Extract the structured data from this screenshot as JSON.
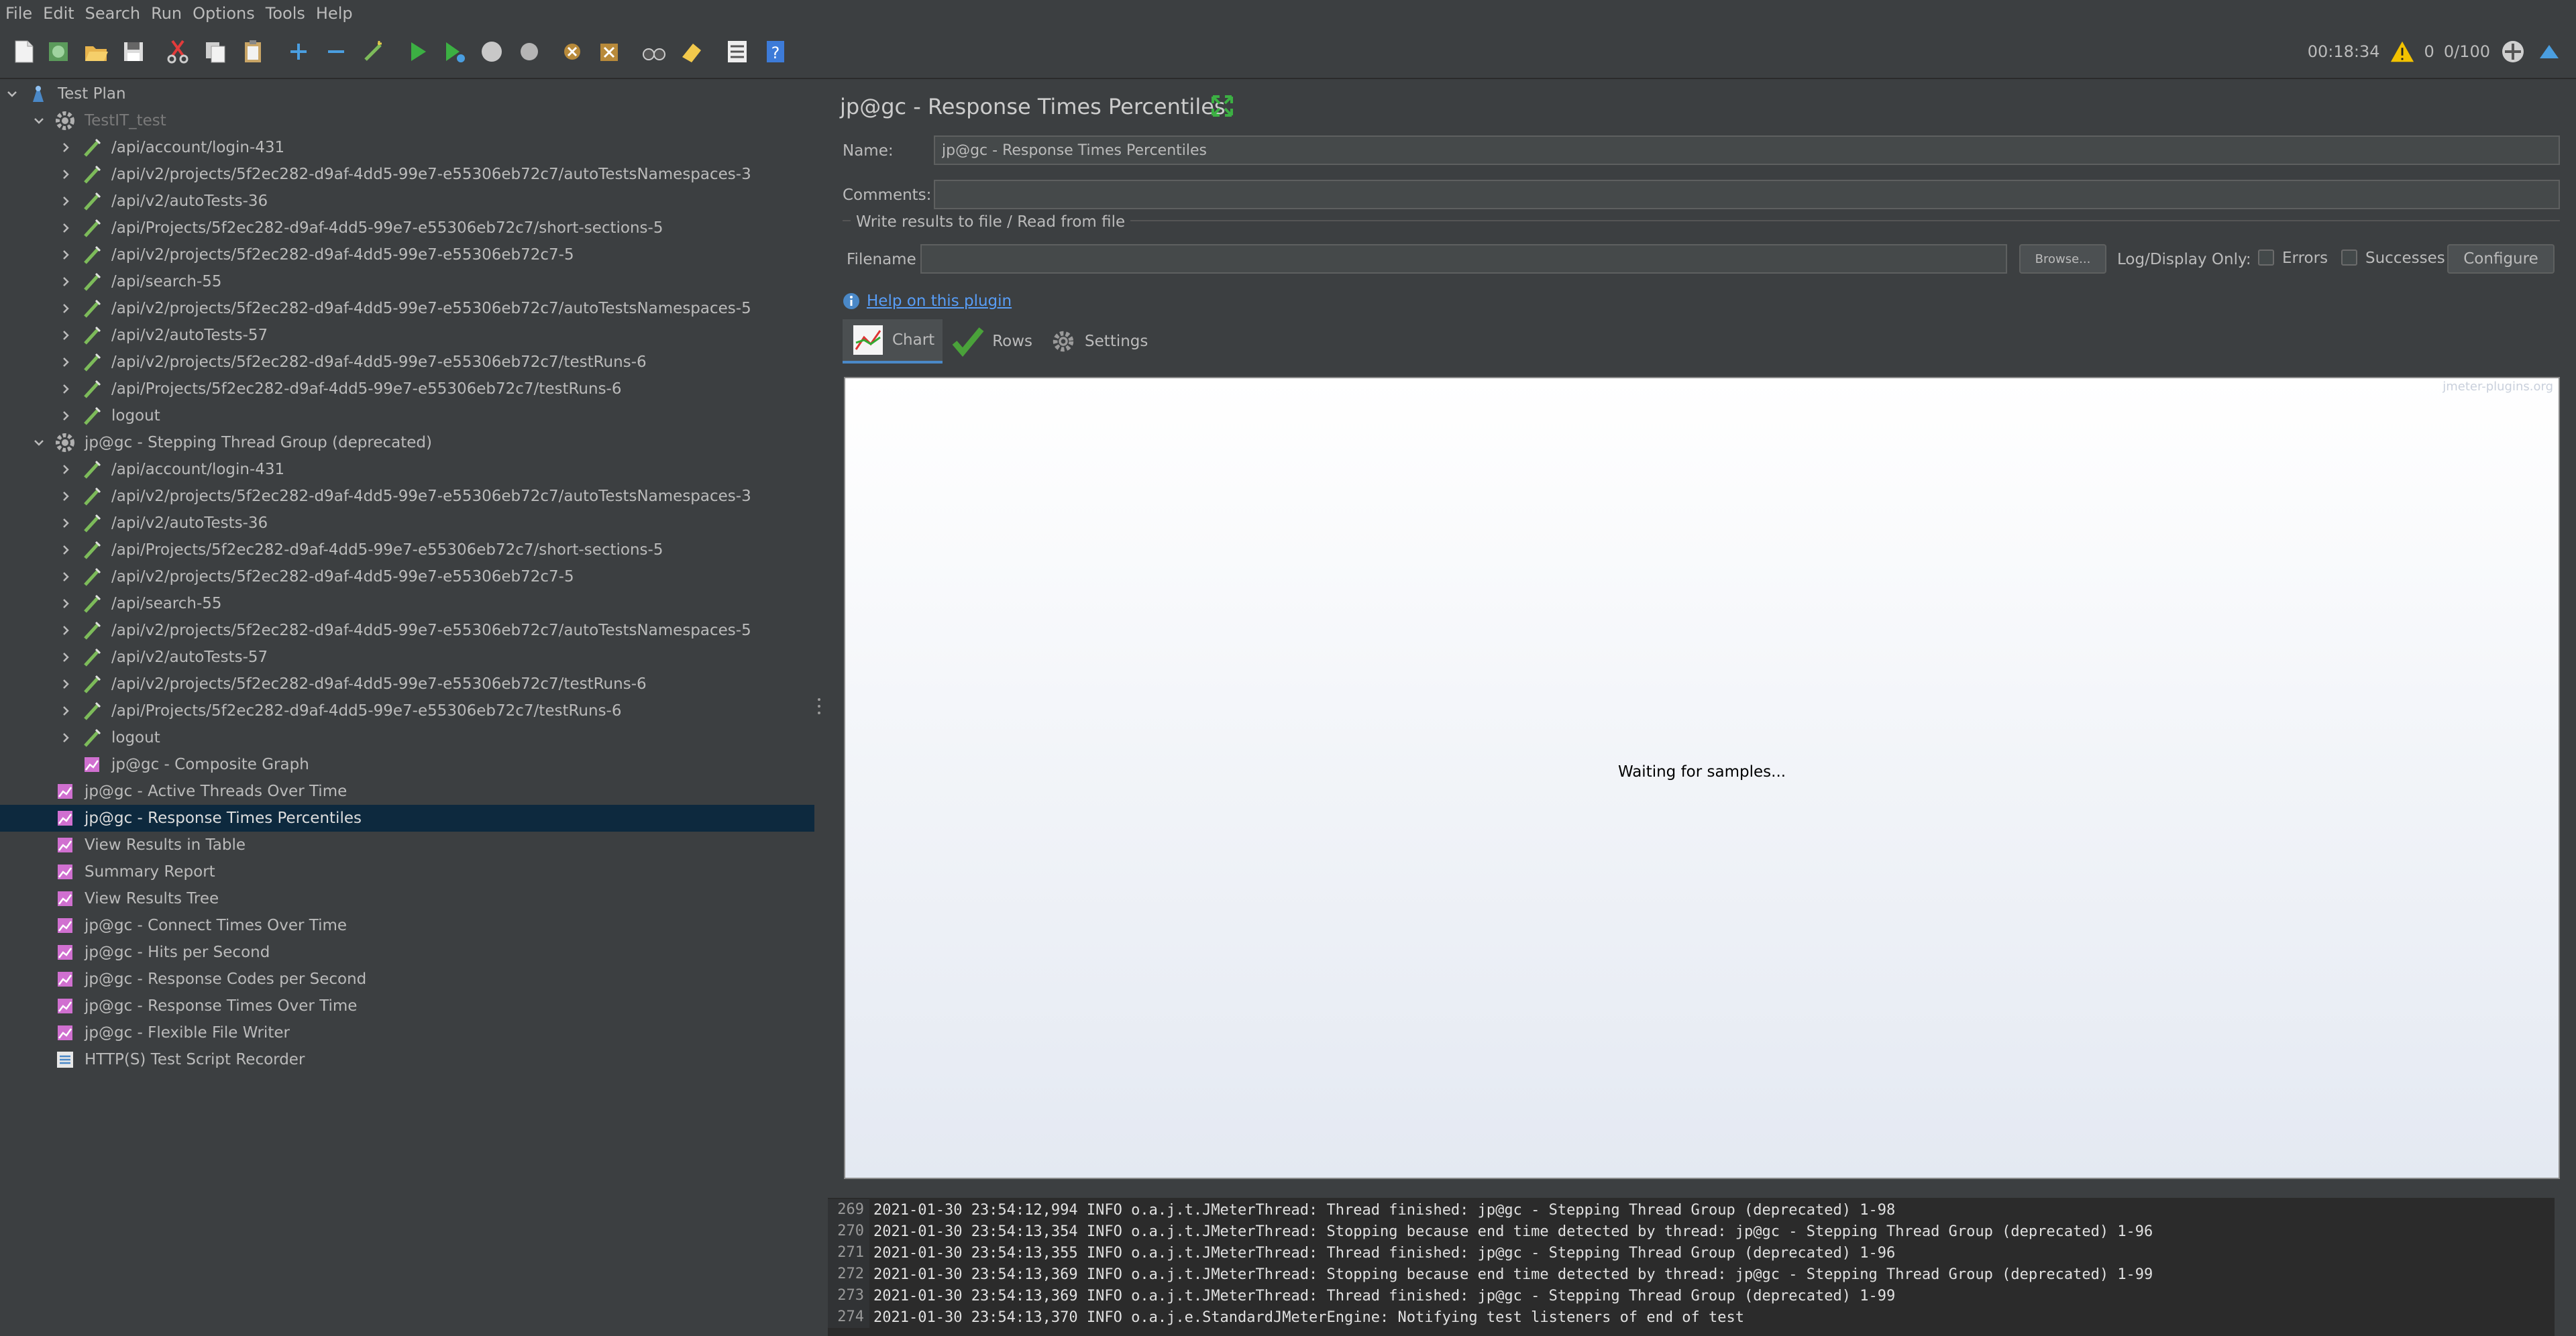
{
  "menu": [
    "File",
    "Edit",
    "Search",
    "Run",
    "Options",
    "Tools",
    "Help"
  ],
  "toolbar": {
    "timer": "00:18:34",
    "warnings": "0",
    "threads": "0/100"
  },
  "tree": [
    {
      "label": "Test Plan",
      "level": 0,
      "chevron": "down",
      "icon": "test-plan-icon"
    },
    {
      "label": "TestIT_test",
      "level": 1,
      "chevron": "down",
      "icon": "thread-group-icon",
      "disabled": true
    },
    {
      "label": "/api/account/login-431",
      "level": 2,
      "chevron": "right",
      "icon": "sampler-icon"
    },
    {
      "label": "/api/v2/projects/5f2ec282-d9af-4dd5-99e7-e55306eb72c7/autoTestsNamespaces-3",
      "level": 2,
      "chevron": "right",
      "icon": "sampler-icon"
    },
    {
      "label": "/api/v2/autoTests-36",
      "level": 2,
      "chevron": "right",
      "icon": "sampler-icon"
    },
    {
      "label": "/api/Projects/5f2ec282-d9af-4dd5-99e7-e55306eb72c7/short-sections-5",
      "level": 2,
      "chevron": "right",
      "icon": "sampler-icon"
    },
    {
      "label": "/api/v2/projects/5f2ec282-d9af-4dd5-99e7-e55306eb72c7-5",
      "level": 2,
      "chevron": "right",
      "icon": "sampler-icon"
    },
    {
      "label": "/api/search-55",
      "level": 2,
      "chevron": "right",
      "icon": "sampler-icon"
    },
    {
      "label": "/api/v2/projects/5f2ec282-d9af-4dd5-99e7-e55306eb72c7/autoTestsNamespaces-5",
      "level": 2,
      "chevron": "right",
      "icon": "sampler-icon"
    },
    {
      "label": "/api/v2/autoTests-57",
      "level": 2,
      "chevron": "right",
      "icon": "sampler-icon"
    },
    {
      "label": "/api/v2/projects/5f2ec282-d9af-4dd5-99e7-e55306eb72c7/testRuns-6",
      "level": 2,
      "chevron": "right",
      "icon": "sampler-icon"
    },
    {
      "label": "/api/Projects/5f2ec282-d9af-4dd5-99e7-e55306eb72c7/testRuns-6",
      "level": 2,
      "chevron": "right",
      "icon": "sampler-icon"
    },
    {
      "label": "logout",
      "level": 2,
      "chevron": "right",
      "icon": "sampler-icon"
    },
    {
      "label": "jp@gc - Stepping Thread Group (deprecated)",
      "level": 1,
      "chevron": "down",
      "icon": "thread-group-icon"
    },
    {
      "label": "/api/account/login-431",
      "level": 2,
      "chevron": "right",
      "icon": "sampler-icon"
    },
    {
      "label": "/api/v2/projects/5f2ec282-d9af-4dd5-99e7-e55306eb72c7/autoTestsNamespaces-3",
      "level": 2,
      "chevron": "right",
      "icon": "sampler-icon"
    },
    {
      "label": "/api/v2/autoTests-36",
      "level": 2,
      "chevron": "right",
      "icon": "sampler-icon"
    },
    {
      "label": "/api/Projects/5f2ec282-d9af-4dd5-99e7-e55306eb72c7/short-sections-5",
      "level": 2,
      "chevron": "right",
      "icon": "sampler-icon"
    },
    {
      "label": "/api/v2/projects/5f2ec282-d9af-4dd5-99e7-e55306eb72c7-5",
      "level": 2,
      "chevron": "right",
      "icon": "sampler-icon"
    },
    {
      "label": "/api/search-55",
      "level": 2,
      "chevron": "right",
      "icon": "sampler-icon"
    },
    {
      "label": "/api/v2/projects/5f2ec282-d9af-4dd5-99e7-e55306eb72c7/autoTestsNamespaces-5",
      "level": 2,
      "chevron": "right",
      "icon": "sampler-icon"
    },
    {
      "label": "/api/v2/autoTests-57",
      "level": 2,
      "chevron": "right",
      "icon": "sampler-icon"
    },
    {
      "label": "/api/v2/projects/5f2ec282-d9af-4dd5-99e7-e55306eb72c7/testRuns-6",
      "level": 2,
      "chevron": "right",
      "icon": "sampler-icon"
    },
    {
      "label": "/api/Projects/5f2ec282-d9af-4dd5-99e7-e55306eb72c7/testRuns-6",
      "level": 2,
      "chevron": "right",
      "icon": "sampler-icon"
    },
    {
      "label": "logout",
      "level": 2,
      "chevron": "right",
      "icon": "sampler-icon"
    },
    {
      "label": "jp@gc - Composite Graph",
      "level": 2,
      "chevron": "none",
      "icon": "listener-icon"
    },
    {
      "label": "jp@gc - Active Threads Over Time",
      "level": 1,
      "chevron": "none",
      "icon": "listener-icon"
    },
    {
      "label": "jp@gc - Response Times Percentiles",
      "level": 1,
      "chevron": "none",
      "icon": "listener-icon",
      "selected": true
    },
    {
      "label": "View Results in Table",
      "level": 1,
      "chevron": "none",
      "icon": "listener-icon"
    },
    {
      "label": "Summary Report",
      "level": 1,
      "chevron": "none",
      "icon": "listener-icon"
    },
    {
      "label": "View Results Tree",
      "level": 1,
      "chevron": "none",
      "icon": "listener-icon"
    },
    {
      "label": "jp@gc - Connect Times Over Time",
      "level": 1,
      "chevron": "none",
      "icon": "listener-icon"
    },
    {
      "label": "jp@gc - Hits per Second",
      "level": 1,
      "chevron": "none",
      "icon": "listener-icon"
    },
    {
      "label": "jp@gc - Response Codes per Second",
      "level": 1,
      "chevron": "none",
      "icon": "listener-icon"
    },
    {
      "label": "jp@gc - Response Times Over Time",
      "level": 1,
      "chevron": "none",
      "icon": "listener-icon"
    },
    {
      "label": "jp@gc - Flexible File Writer",
      "level": 1,
      "chevron": "none",
      "icon": "listener-icon"
    },
    {
      "label": "HTTP(S) Test Script Recorder",
      "level": 1,
      "chevron": "none",
      "icon": "recorder-icon"
    }
  ],
  "panel": {
    "title": "jp@gc - Response Times Percentiles",
    "name_label": "Name:",
    "name_value": "jp@gc - Response Times Percentiles",
    "comments_label": "Comments:",
    "comments_value": "",
    "file_group_title": "Write results to file / Read from file",
    "filename_label": "Filename",
    "filename_value": "",
    "browse_label": "Browse...",
    "log_display_label": "Log/Display Only:",
    "errors_label": "Errors",
    "successes_label": "Successes",
    "configure_label": "Configure",
    "help_link": "Help on this plugin",
    "tabs": [
      {
        "label": "Chart",
        "icon": "chart-icon",
        "active": true
      },
      {
        "label": "Rows",
        "icon": "checkmark-icon"
      },
      {
        "label": "Settings",
        "icon": "gear-icon"
      }
    ],
    "chart_watermark": "jmeter-plugins.org",
    "chart_status": "Waiting for samples..."
  },
  "log": [
    {
      "num": "269",
      "text": "2021-01-30 23:54:12,994 INFO o.a.j.t.JMeterThread: Thread finished: jp@gc - Stepping Thread Group (deprecated) 1-98"
    },
    {
      "num": "270",
      "text": "2021-01-30 23:54:13,354 INFO o.a.j.t.JMeterThread: Stopping because end time detected by thread: jp@gc - Stepping Thread Group (deprecated) 1-96"
    },
    {
      "num": "271",
      "text": "2021-01-30 23:54:13,355 INFO o.a.j.t.JMeterThread: Thread finished: jp@gc - Stepping Thread Group (deprecated) 1-96"
    },
    {
      "num": "272",
      "text": "2021-01-30 23:54:13,369 INFO o.a.j.t.JMeterThread: Stopping because end time detected by thread: jp@gc - Stepping Thread Group (deprecated) 1-99"
    },
    {
      "num": "273",
      "text": "2021-01-30 23:54:13,369 INFO o.a.j.t.JMeterThread: Thread finished: jp@gc - Stepping Thread Group (deprecated) 1-99"
    },
    {
      "num": "274",
      "text": "2021-01-30 23:54:13,370 INFO o.a.j.e.StandardJMeterEngine: Notifying test listeners of end of test"
    }
  ]
}
